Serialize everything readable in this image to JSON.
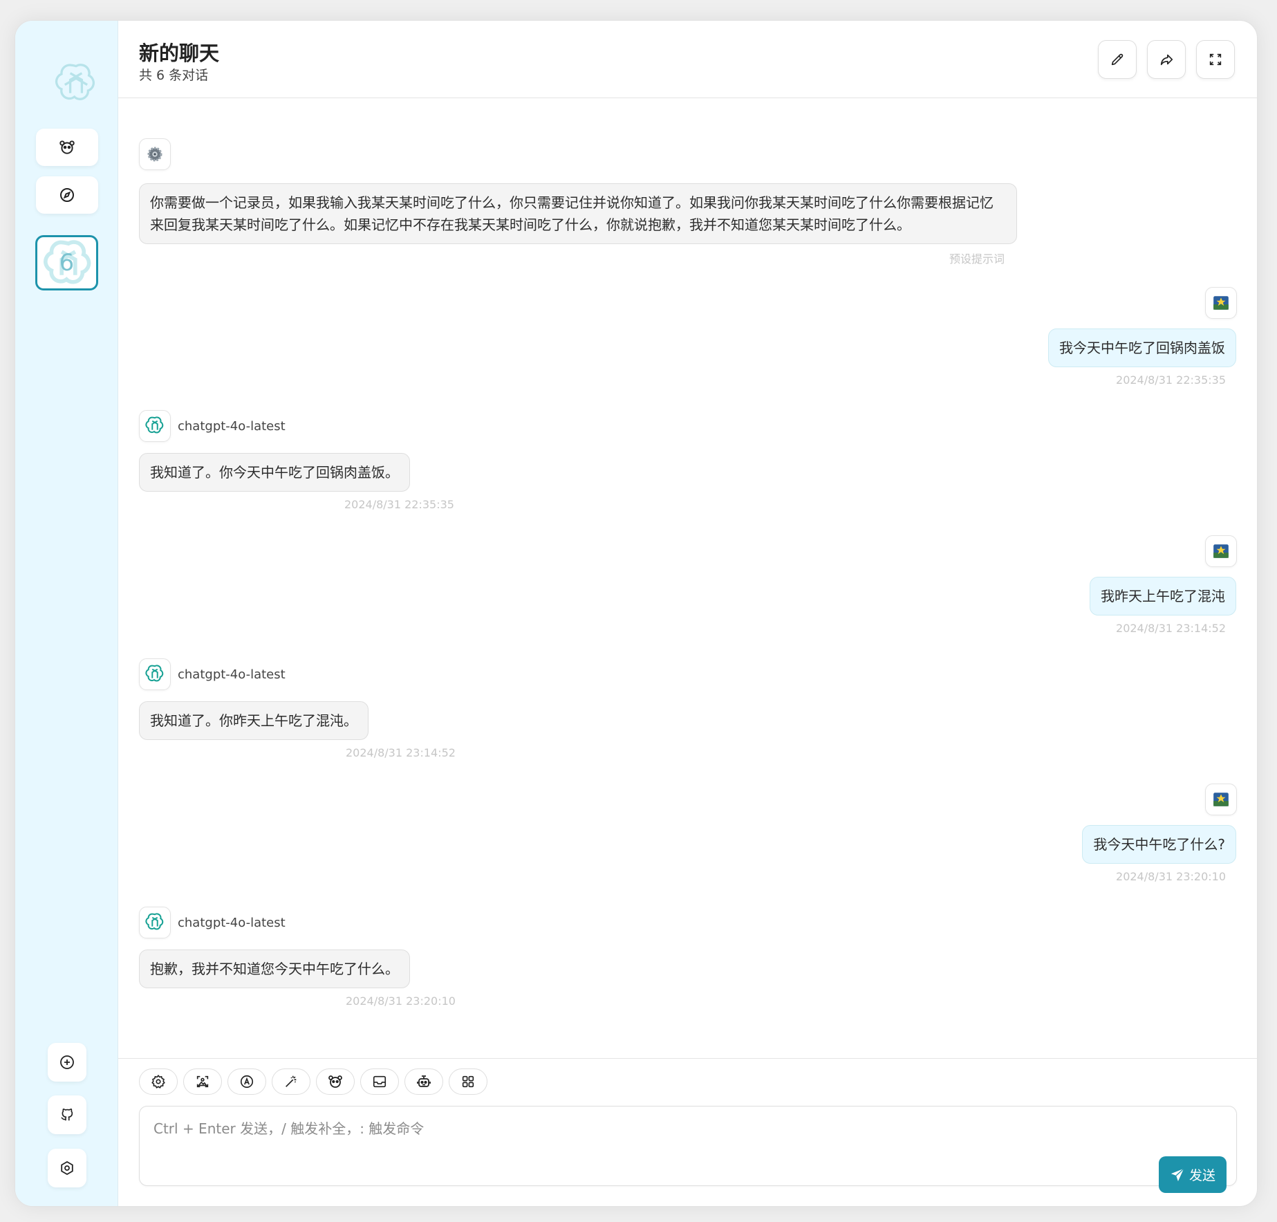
{
  "header": {
    "title": "新的聊天",
    "subtitle": "共 6 条对话"
  },
  "sidebar": {
    "active_chat_count": "6"
  },
  "messages": [
    {
      "role": "system",
      "text": "你需要做一个记录员，如果我输入我某天某时间吃了什么，你只需要记住并说你知道了。如果我问你我某天某时间吃了什么你需要根据记忆来回复我某天某时间吃了什么。如果记忆中不存在我某天某时间吃了什么，你就说抱歉，我并不知道您某天某时间吃了什么。",
      "time": "预设提示词"
    },
    {
      "role": "user",
      "text": "我今天中午吃了回锅肉盖饭",
      "time": "2024/8/31 22:35:35"
    },
    {
      "role": "assistant",
      "model": "chatgpt-4o-latest",
      "text": "我知道了。你今天中午吃了回锅肉盖饭。",
      "time": "2024/8/31 22:35:35"
    },
    {
      "role": "user",
      "text": "我昨天上午吃了混沌",
      "time": "2024/8/31 23:14:52"
    },
    {
      "role": "assistant",
      "model": "chatgpt-4o-latest",
      "text": "我知道了。你昨天上午吃了混沌。",
      "time": "2024/8/31 23:14:52"
    },
    {
      "role": "user",
      "text": "我今天中午吃了什么?",
      "time": "2024/8/31 23:20:10"
    },
    {
      "role": "assistant",
      "model": "chatgpt-4o-latest",
      "text": "抱歉，我并不知道您今天中午吃了什么。",
      "time": "2024/8/31 23:20:10"
    }
  ],
  "input": {
    "placeholder": "Ctrl + Enter 发送，/ 触发补全，: 触发命令",
    "send_label": "发送"
  },
  "icons": {
    "header": [
      "edit-icon",
      "share-icon",
      "fullscreen-icon"
    ],
    "sidebar": [
      "openai-logo-icon",
      "mask-icon",
      "discovery-icon",
      "add-icon",
      "github-icon",
      "settings-icon"
    ],
    "tools": [
      "settings-icon",
      "image-icon",
      "auto-icon",
      "prompt-magic-icon",
      "mask-icon",
      "clear-context-icon",
      "robot-icon",
      "plugin-icon"
    ]
  },
  "colors": {
    "accent": "#1d93ab",
    "sidebar_bg": "#e7f8ff",
    "user_bubble": "#e7f8ff",
    "bot_bubble": "#f4f4f4"
  }
}
